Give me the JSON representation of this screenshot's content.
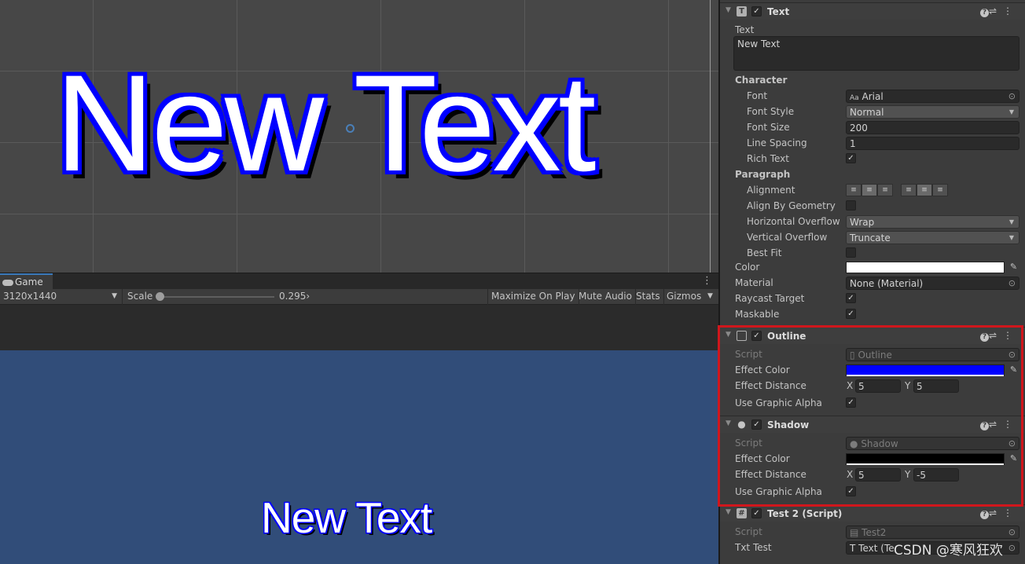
{
  "scene": {
    "big_text": "New Text"
  },
  "game": {
    "tab_label": "Game",
    "resolution": "3120x1440",
    "scale_label": "Scale",
    "scale_value": "0.295›",
    "buttons": {
      "maximize": "Maximize On Play",
      "mute": "Mute Audio",
      "stats": "Stats",
      "gizmos": "Gizmos"
    },
    "rendered_text": "New Text"
  },
  "inspector": {
    "text_component": {
      "title": "Text",
      "text_label": "Text",
      "text_value": "New Text",
      "character_header": "Character",
      "font_label": "Font",
      "font_value": "Arial",
      "font_icon": "Aa",
      "font_style_label": "Font Style",
      "font_style_value": "Normal",
      "font_size_label": "Font Size",
      "font_size_value": "200",
      "line_spacing_label": "Line Spacing",
      "line_spacing_value": "1",
      "rich_text_label": "Rich Text",
      "rich_text_checked": true,
      "paragraph_header": "Paragraph",
      "alignment_label": "Alignment",
      "align_by_geometry_label": "Align By Geometry",
      "align_by_geometry_checked": false,
      "horizontal_overflow_label": "Horizontal Overflow",
      "horizontal_overflow_value": "Wrap",
      "vertical_overflow_label": "Vertical Overflow",
      "vertical_overflow_value": "Truncate",
      "best_fit_label": "Best Fit",
      "best_fit_checked": false,
      "color_label": "Color",
      "color_value": "#ffffff",
      "material_label": "Material",
      "material_value": "None (Material)",
      "raycast_label": "Raycast Target",
      "raycast_checked": true,
      "maskable_label": "Maskable",
      "maskable_checked": true
    },
    "outline_component": {
      "title": "Outline",
      "script_label": "Script",
      "script_value": "Outline",
      "effect_color_label": "Effect Color",
      "effect_color": "#0000ff",
      "effect_distance_label": "Effect Distance",
      "x_label": "X",
      "x_value": "5",
      "y_label": "Y",
      "y_value": "5",
      "use_alpha_label": "Use Graphic Alpha",
      "use_alpha_checked": true
    },
    "shadow_component": {
      "title": "Shadow",
      "script_label": "Script",
      "script_value": "Shadow",
      "effect_color_label": "Effect Color",
      "effect_color": "#000000",
      "effect_distance_label": "Effect Distance",
      "x_label": "X",
      "x_value": "5",
      "y_label": "Y",
      "y_value": "-5",
      "use_alpha_label": "Use Graphic Alpha",
      "use_alpha_checked": true
    },
    "test2_component": {
      "title": "Test 2 (Script)",
      "script_label": "Script",
      "script_value": "Test2",
      "txt_test_label": "Txt Test",
      "txt_test_value": "Text (Te"
    }
  },
  "watermark": "CSDN @寒风狂欢"
}
